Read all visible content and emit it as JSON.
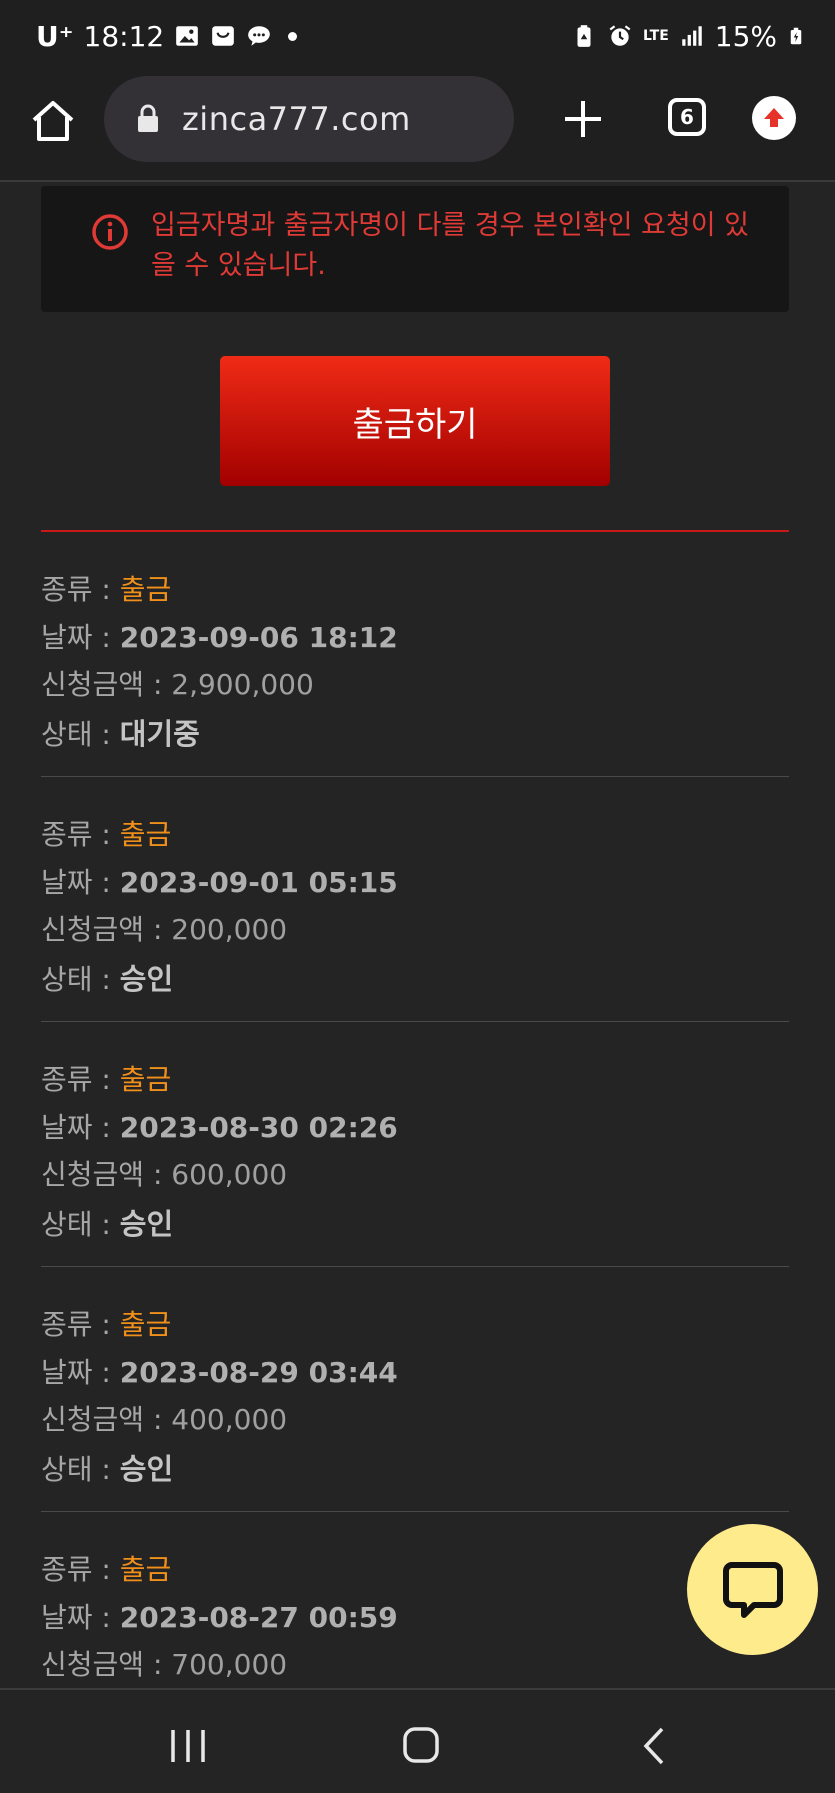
{
  "status_bar": {
    "carrier": "U⁺",
    "time": "18:12",
    "network": "LTE",
    "battery": "15%"
  },
  "browser": {
    "url": "zinca777.com",
    "tab_count": "6"
  },
  "notice": {
    "text": "입금자명과 출금자명이 다를 경우 본인확인 요청이 있을 수 있습니다."
  },
  "withdraw_button": {
    "label": "출금하기"
  },
  "labels": {
    "type": "종류 : ",
    "date": "날짜 : ",
    "amount": "신청금액 : ",
    "status": "상태 : "
  },
  "records": [
    {
      "type": "출금",
      "date": "2023-09-06 18:12",
      "amount": "2,900,000",
      "status": "대기중"
    },
    {
      "type": "출금",
      "date": "2023-09-01 05:15",
      "amount": "200,000",
      "status": "승인"
    },
    {
      "type": "출금",
      "date": "2023-08-30 02:26",
      "amount": "600,000",
      "status": "승인"
    },
    {
      "type": "출금",
      "date": "2023-08-29 03:44",
      "amount": "400,000",
      "status": "승인"
    },
    {
      "type": "출금",
      "date": "2023-08-27 00:59",
      "amount": "700,000",
      "status": ""
    }
  ],
  "colors": {
    "background": "#242424",
    "notice_text": "#e03a36",
    "type_orange": "#f0901b",
    "button_top": "#f02b16",
    "button_bottom": "#a10000",
    "chat_bubble": "#fdeb8c"
  }
}
